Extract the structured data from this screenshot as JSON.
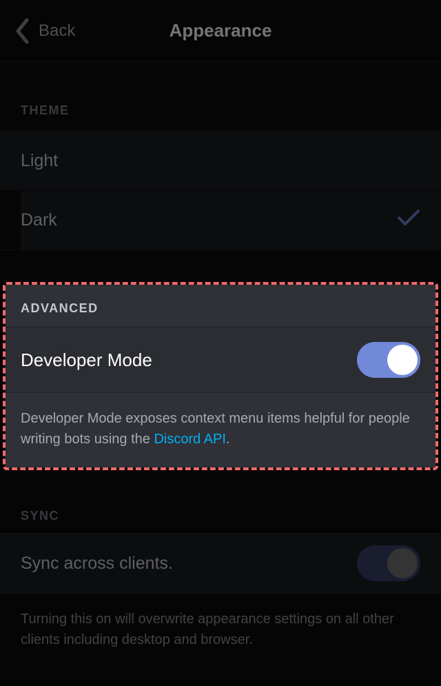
{
  "header": {
    "back_label": "Back",
    "title": "Appearance"
  },
  "theme": {
    "section_label": "THEME",
    "options": {
      "light": "Light",
      "dark": "Dark"
    },
    "selected": "dark"
  },
  "advanced": {
    "section_label": "ADVANCED",
    "developer_mode": {
      "label": "Developer Mode",
      "enabled": true
    },
    "description_prefix": "Developer Mode exposes context menu items helpful for people writing bots using the ",
    "description_link_text": "Discord API",
    "description_suffix": "."
  },
  "sync": {
    "section_label": "SYNC",
    "label": "Sync across clients.",
    "enabled": false,
    "description": "Turning this on will overwrite appearance settings on all other clients including desktop and browser."
  }
}
